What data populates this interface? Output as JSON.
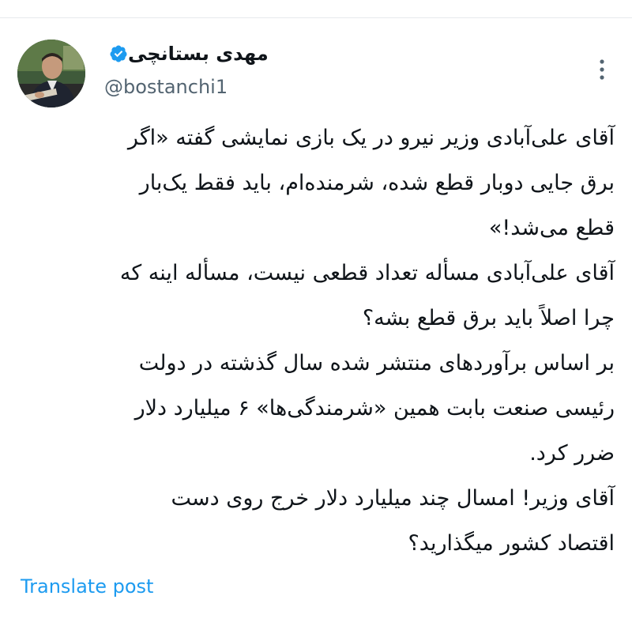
{
  "author": {
    "display_name": "مهدی بستانچی",
    "handle": "@bostanchi1",
    "verified": true,
    "verified_color": "#1d9bf0"
  },
  "tweet": {
    "lines": [
      "آقای علی‌آبادی وزیر نیرو در یک بازی نمایشی گفته «اگر",
      "برق جایی دوبار قطع شده، شرمنده‌ام، باید فقط یک‌بار",
      "قطع می‌شد!»",
      "آقای علی‌آبادی مسأله تعداد قطعی نیست، مسأله اینه که",
      "چرا اصلاً باید برق قطع بشه؟",
      "بر اساس برآوردهای منتشر شده سال گذشته در دولت",
      "رئیسی صنعت بابت همین «شرمندگی‌ها» ۶ میلیارد دلار",
      "ضرر کرد.",
      "آقای وزیر! امسال چند میلیارد دلار خرج روی دست",
      "اقتصاد کشور میگذارید؟"
    ]
  },
  "actions": {
    "translate_label": "Translate post",
    "more_icon": "more-vertical-icon"
  },
  "colors": {
    "text": "#0f1419",
    "secondary": "#536471",
    "link": "#1d9bf0"
  }
}
